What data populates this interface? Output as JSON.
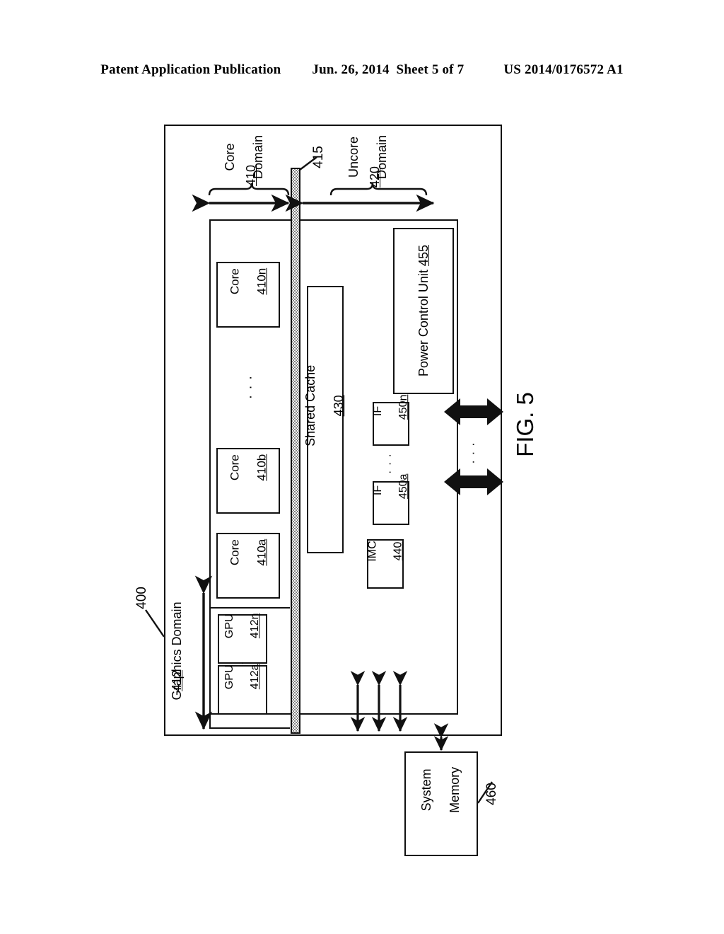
{
  "header": {
    "publication": "Patent Application Publication",
    "date_sheet": "Jun. 26, 2014  Sheet 5 of 7",
    "patent_number": "US 2014/0176572 A1"
  },
  "figure": {
    "caption": "FIG. 5",
    "processor_ref": "400",
    "system_memory_ref": "460",
    "interconnect_ref": "415"
  },
  "domains": {
    "core": {
      "name_line1": "Core",
      "name_line2": "Domain",
      "ref": "410"
    },
    "uncore": {
      "name_line1": "Uncore",
      "name_line2": "Domain",
      "ref": "420"
    },
    "graphics": {
      "name": "Graphics Domain",
      "ref": "412"
    }
  },
  "cores": [
    {
      "name": "Core",
      "ref": "410a"
    },
    {
      "name": "Core",
      "ref": "410b"
    },
    {
      "name": "Core",
      "ref": "410n"
    }
  ],
  "core_ellipsis": "· · ·",
  "gpus": [
    {
      "name": "GPU",
      "ref": "412a"
    },
    {
      "name": "GPU",
      "ref": "412n"
    }
  ],
  "gpu_ellipsis": "· · ·",
  "shared_cache": {
    "name": "Shared Cache",
    "ref": "430"
  },
  "imc": {
    "name": "IMC",
    "ref": "440"
  },
  "interfaces": [
    {
      "name": "IF",
      "ref": "450a"
    },
    {
      "name": "IF",
      "ref": "450n"
    }
  ],
  "if_ellipsis": "· · ·",
  "power_control_unit": {
    "name": "Power Control Unit",
    "ref": "455"
  },
  "system_memory": {
    "line1": "System",
    "line2": "Memory"
  },
  "link_ellipsis": "· · ·",
  "colors": {
    "ink": "#111111",
    "paper": "#ffffff",
    "stipple": "#5a5a5a"
  }
}
